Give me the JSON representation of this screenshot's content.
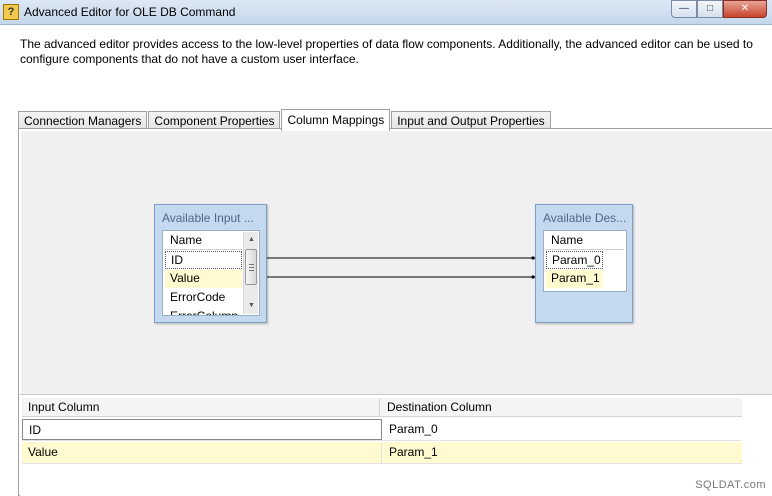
{
  "window": {
    "title": "Advanced Editor for OLE DB Command",
    "minimize_glyph": "—",
    "maximize_glyph": "□",
    "close_glyph": "✕"
  },
  "description": "The advanced editor provides access to the low-level properties of data flow components. Additionally, the advanced editor can be used to configure components that do not have a custom user interface.",
  "tabs": [
    {
      "label": "Connection Managers",
      "active": false
    },
    {
      "label": "Component Properties",
      "active": false
    },
    {
      "label": "Column Mappings",
      "active": true
    },
    {
      "label": "Input and Output Properties",
      "active": false
    }
  ],
  "input_box": {
    "title": "Available Input ...",
    "header": "Name",
    "rows": [
      "ID",
      "Value",
      "ErrorCode",
      "ErrorColumn"
    ]
  },
  "dest_box": {
    "title": "Available Des...",
    "header": "Name",
    "rows": [
      "Param_0",
      "Param_1"
    ]
  },
  "grid": {
    "headers": {
      "input": "Input Column",
      "destination": "Destination Column"
    },
    "rows": [
      {
        "input": "ID",
        "destination": "Param_0"
      },
      {
        "input": "Value",
        "destination": "Param_1"
      }
    ]
  },
  "watermark": "SQLDAT.com",
  "colors": {
    "highlight_row": "#fffad0",
    "box_fill": "#c4d9ef",
    "box_border": "#7ea0c8"
  }
}
